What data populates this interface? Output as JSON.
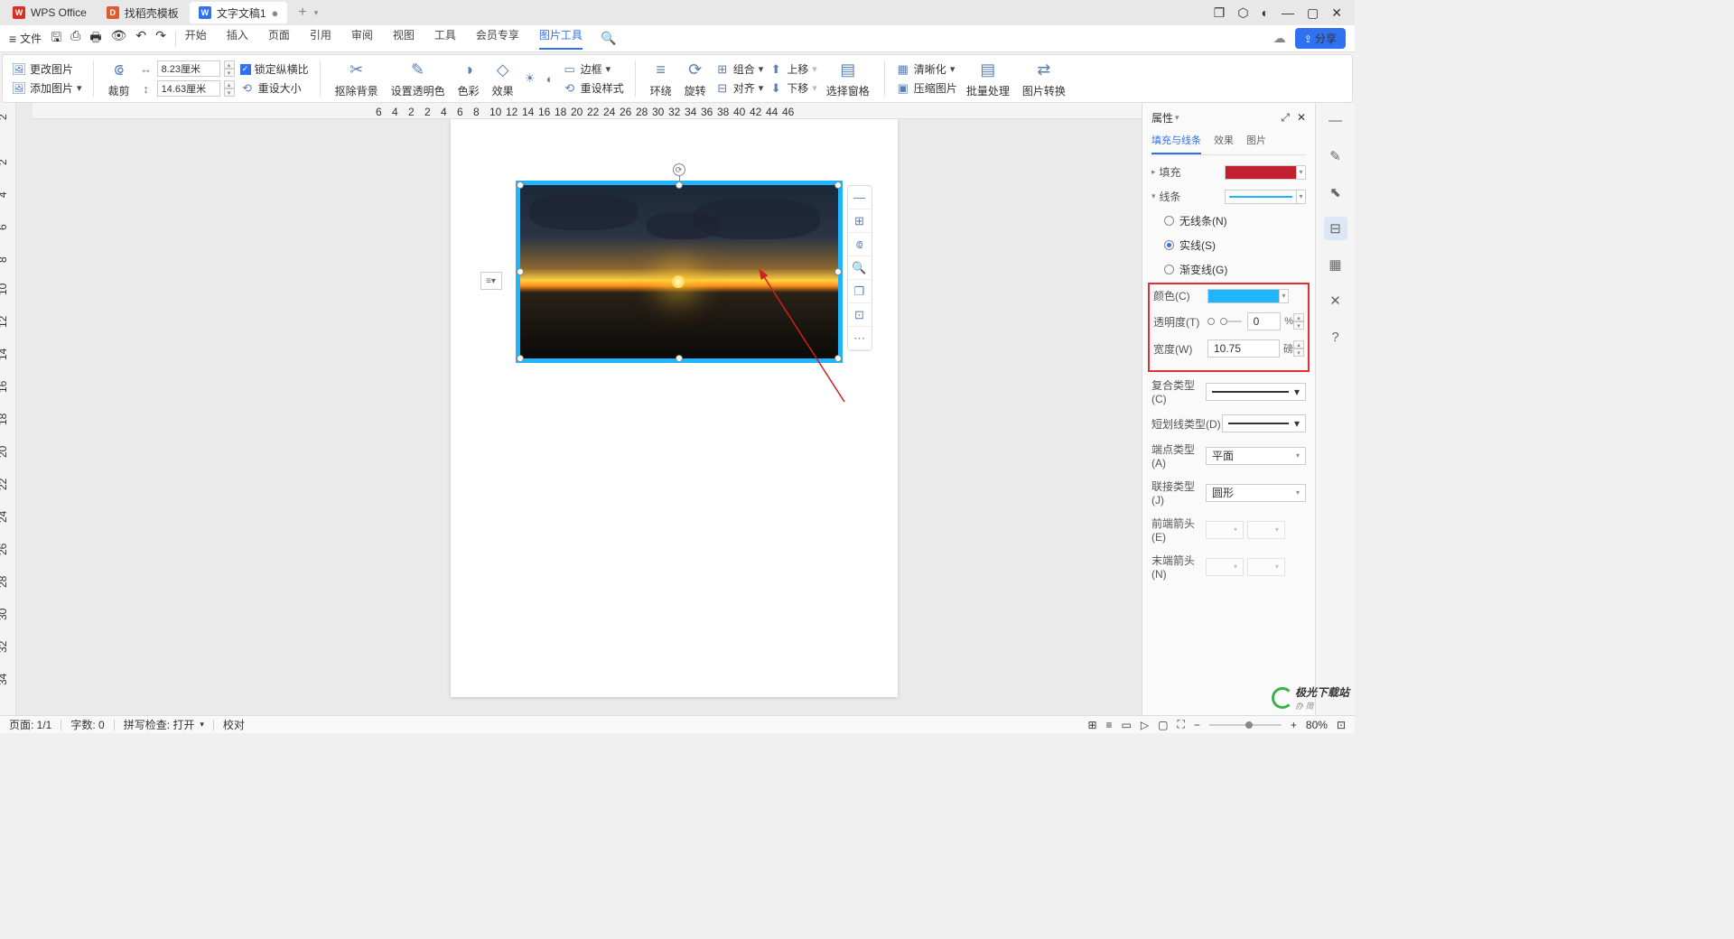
{
  "tabs": {
    "home": "WPS Office",
    "template": "找稻壳模板",
    "doc": "文字文稿1"
  },
  "menubar": {
    "file": "文件",
    "items": [
      "开始",
      "插入",
      "页面",
      "引用",
      "审阅",
      "视图",
      "工具",
      "会员专享",
      "图片工具"
    ]
  },
  "share_label": "分享",
  "ribbon": {
    "change_pic": "更改图片",
    "add_pic": "添加图片",
    "crop": "裁剪",
    "width": "8.23厘米",
    "height": "14.63厘米",
    "lock_ratio": "锁定纵横比",
    "reset_size": "重设大小",
    "remove_bg": "抠除背景",
    "set_trans": "设置透明色",
    "color": "色彩",
    "effect": "效果",
    "border": "边框",
    "reset_style": "重设样式",
    "wrap": "环绕",
    "rotate": "旋转",
    "combine": "组合",
    "align": "对齐",
    "up": "上移",
    "down": "下移",
    "sel_pane": "选择窗格",
    "sharpen": "清晰化",
    "compress": "压缩图片",
    "batch": "批量处理",
    "convert": "图片转换"
  },
  "ruler_h": [
    "6",
    "4",
    "2",
    "2",
    "4",
    "6",
    "8",
    "10",
    "12",
    "14",
    "16",
    "18",
    "20",
    "22",
    "24",
    "26",
    "28",
    "30",
    "32",
    "34",
    "36",
    "38",
    "40",
    "42",
    "44",
    "46"
  ],
  "ruler_v": [
    "2",
    "2",
    "4",
    "6",
    "8",
    "10",
    "12",
    "14",
    "16",
    "18",
    "20",
    "22",
    "24",
    "26",
    "28",
    "30",
    "32",
    "34"
  ],
  "panel": {
    "title": "属性",
    "tabs": {
      "fill": "填充与线条",
      "effect": "效果",
      "pic": "图片"
    },
    "fill_label": "填充",
    "fill_color": "#c22030",
    "line_label": "线条",
    "line_color": "#1fb5ff",
    "no_line": "无线条(N)",
    "solid": "实线(S)",
    "gradient": "渐变线(G)",
    "color_lbl": "颜色(C)",
    "color_val": "#1fb5ff",
    "opacity_lbl": "透明度(T)",
    "opacity_val": "0",
    "opacity_unit": "%",
    "width_lbl": "宽度(W)",
    "width_val": "10.75",
    "width_unit": "磅",
    "compound_lbl": "复合类型(C)",
    "dash_lbl": "短划线类型(D)",
    "cap_lbl": "端点类型(A)",
    "cap_val": "平面",
    "join_lbl": "联接类型(J)",
    "join_val": "圆形",
    "arrow_start": "前端箭头(E)",
    "arrow_end": "末端箭头(N)"
  },
  "status": {
    "page": "页面: 1/1",
    "words": "字数: 0",
    "spell": "拼写检查: 打开",
    "proof": "校对",
    "zoom": "80%"
  },
  "watermark": {
    "t1": "极光下载站",
    "t2": "办 简"
  }
}
